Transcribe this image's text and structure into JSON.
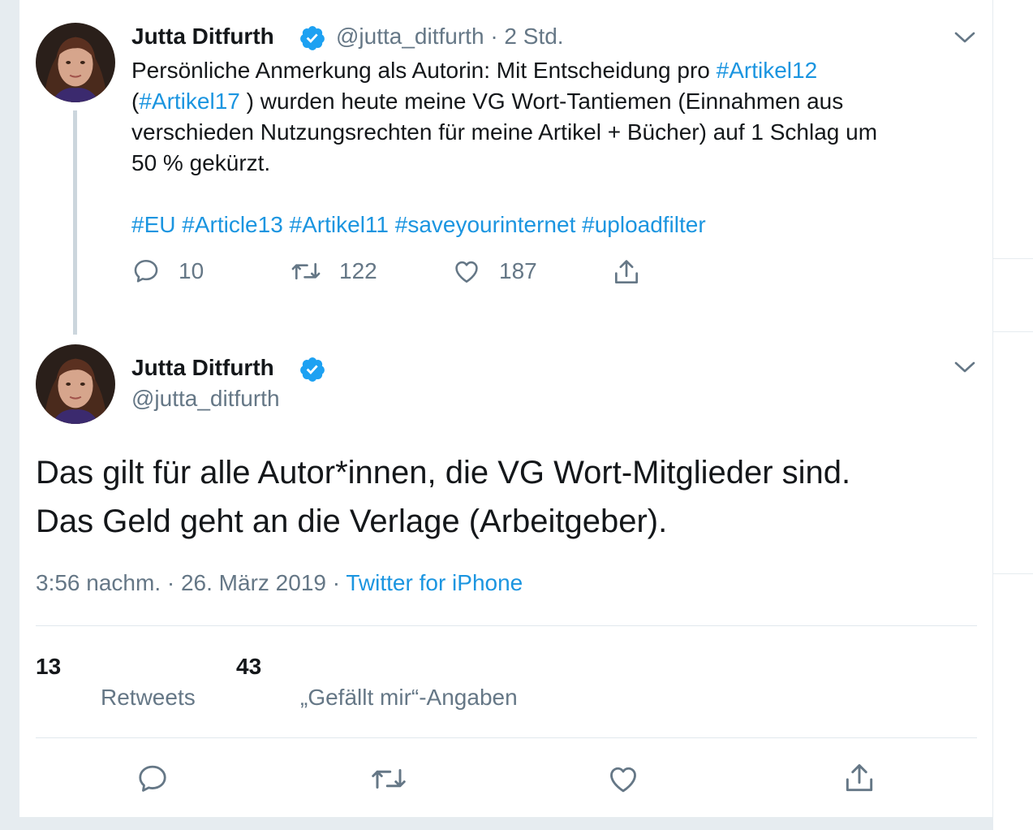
{
  "reply_tweet": {
    "author_name": "Jutta Ditfurth",
    "handle": "@jutta_ditfurth",
    "time": "· 2 Std.",
    "text_lines": [
      [
        {
          "t": "Persönliche Anmerkung als Autorin: Mit Entscheidung pro "
        },
        {
          "t": "#Artikel12",
          "tag": true
        }
      ],
      [
        {
          "t": "("
        },
        {
          "t": "#Artikel17",
          "tag": true
        },
        {
          "t": " ) wurden heute meine VG Wort-Tantiemen (Einnahmen aus"
        }
      ],
      [
        {
          "t": "verschieden Nutzungsrechten für meine Artikel + Bücher) auf 1 Schlag um"
        }
      ],
      [
        {
          "t": "50 % gekürzt."
        }
      ]
    ],
    "hashtags_line": [
      {
        "t": "#EU",
        "tag": true
      },
      {
        "t": " "
      },
      {
        "t": "#Article13",
        "tag": true
      },
      {
        "t": " "
      },
      {
        "t": "#Artikel11",
        "tag": true
      },
      {
        "t": " "
      },
      {
        "t": "#saveyourinternet",
        "tag": true
      },
      {
        "t": " "
      },
      {
        "t": "#uploadfilter",
        "tag": true
      }
    ],
    "replies": "10",
    "retweets": "122",
    "likes": "187"
  },
  "main_tweet": {
    "author_name": "Jutta Ditfurth",
    "handle": "@jutta_ditfurth",
    "text_line1": "Das gilt für alle Autor*innen, die VG Wort-Mitglieder sind.",
    "text_line2": "Das Geld geht an die Verlage (Arbeitgeber).",
    "timestamp": "3:56 nachm. · 26. März 2019 · ",
    "source": "Twitter for iPhone",
    "retweet_count": "13",
    "retweet_label": "Retweets",
    "like_count": "43",
    "like_label": "„Gefällt mir“-Angaben"
  },
  "colors": {
    "link": "#1b95e0",
    "secondary": "#657786",
    "verified": "#1da1f2",
    "background": "#e6ecf0"
  },
  "icons": [
    "reply-icon",
    "retweet-icon",
    "like-icon",
    "share-icon",
    "verified-badge-icon",
    "chevron-down-icon"
  ]
}
